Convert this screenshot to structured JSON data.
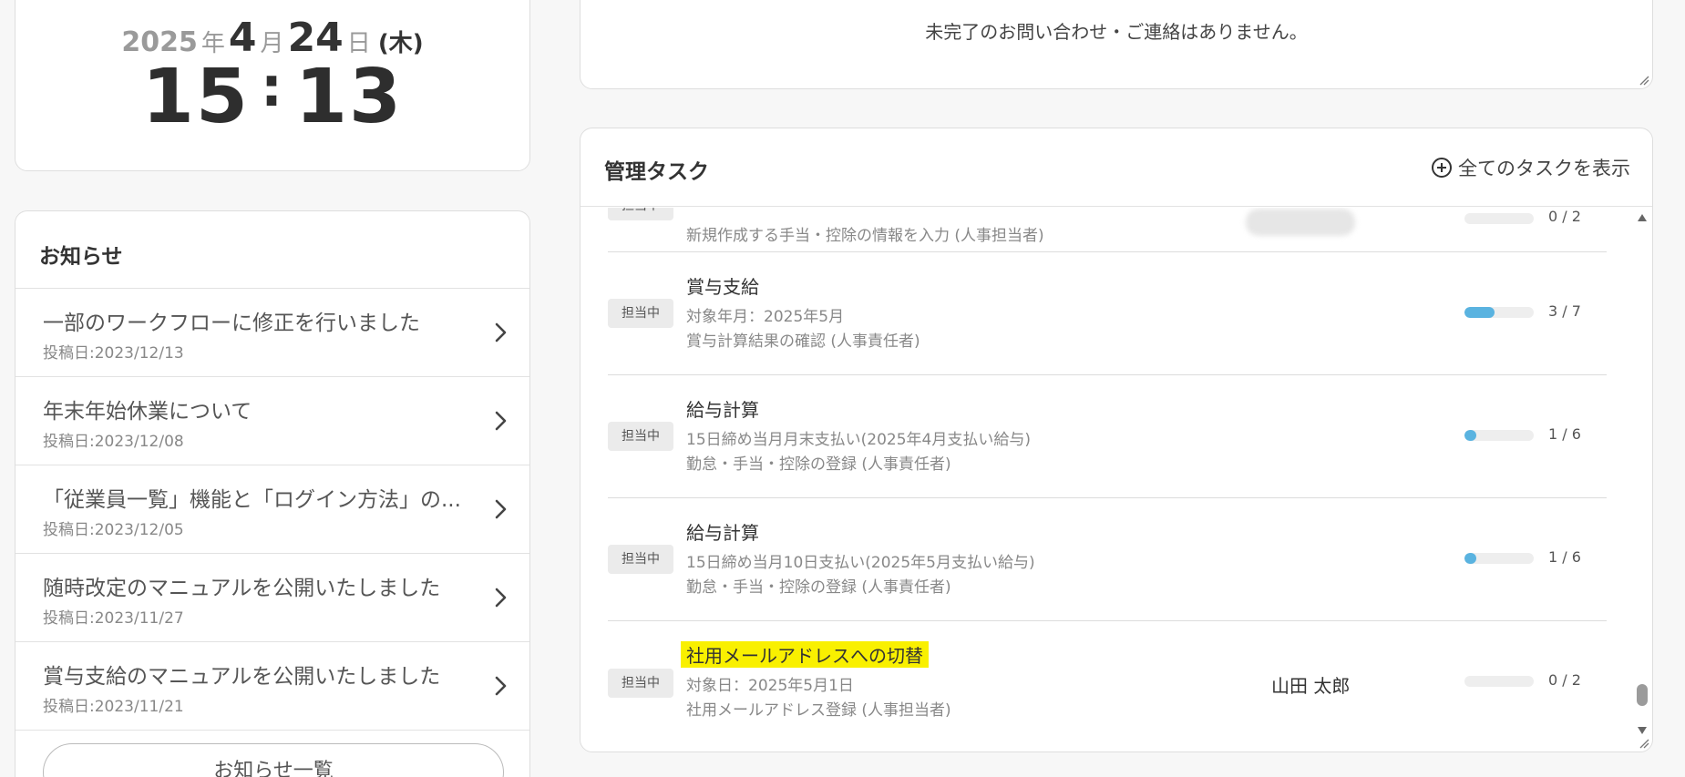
{
  "clock": {
    "year": "2025",
    "year_unit": "年",
    "month": "4",
    "month_unit": "月",
    "day": "24",
    "day_unit": "日",
    "weekday": "(木)",
    "hour": "15",
    "colon": ":",
    "minute": "13"
  },
  "news": {
    "title": "お知らせ",
    "items": [
      {
        "title": "一部のワークフローに修正を行いました",
        "date": "投稿日:2023/12/13"
      },
      {
        "title": "年末年始休業について",
        "date": "投稿日:2023/12/08"
      },
      {
        "title": "「従業員一覧」機能と「ログイン方法」の...",
        "date": "投稿日:2023/12/05"
      },
      {
        "title": "随時改定のマニュアルを公開いたしました",
        "date": "投稿日:2023/11/27"
      },
      {
        "title": "賞与支給のマニュアルを公開いたしました",
        "date": "投稿日:2023/11/21"
      }
    ],
    "more_label": "お知らせ一覧"
  },
  "inquiry": {
    "message": "未完了のお問い合わせ・ご連絡はありません。"
  },
  "tasks": {
    "title": "管理タスク",
    "show_all_label": "全てのタスクを表示",
    "rows": [
      {
        "status": "担当中",
        "name": "",
        "sub1": "",
        "sub2": "新規作成する手当・控除の情報を入力 (人事担当者)",
        "assignee": "",
        "count": "0 / 2",
        "progress": 0
      },
      {
        "status": "担当中",
        "name": "賞与支給",
        "sub1": "対象年月：2025年5月",
        "sub2": "賞与計算結果の確認 (人事責任者)",
        "assignee": "",
        "count": "3 / 7",
        "progress": 0.43
      },
      {
        "status": "担当中",
        "name": "給与計算",
        "sub1": "15日締め当月月末支払い(2025年4月支払い給与)",
        "sub2": "勤怠・手当・控除の登録 (人事責任者)",
        "assignee": "",
        "count": "1 / 6",
        "progress": 0.17
      },
      {
        "status": "担当中",
        "name": "給与計算",
        "sub1": "15日締め当月10日支払い(2025年5月支払い給与)",
        "sub2": "勤怠・手当・控除の登録 (人事責任者)",
        "assignee": "",
        "count": "1 / 6",
        "progress": 0.17
      },
      {
        "status": "担当中",
        "name": "社用メールアドレスへの切替",
        "sub1": "対象日：2025年5月1日",
        "sub2": "社用メールアドレス登録 (人事担当者)",
        "assignee": "山田 太郎",
        "count": "0 / 2",
        "progress": 0
      }
    ]
  },
  "colors": {
    "accent": "#5ab3e0",
    "highlight": "#f9f000"
  }
}
